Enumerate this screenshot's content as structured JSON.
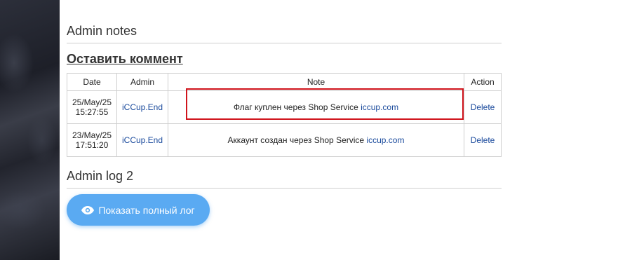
{
  "admin_notes": {
    "title": "Admin notes",
    "leave_comment": "Оставить коммент",
    "columns": {
      "date": "Date",
      "admin": "Admin",
      "note": "Note",
      "action": "Action"
    },
    "rows": [
      {
        "date_line1": "25/May/25",
        "date_line2": "15:27:55",
        "admin": "iCCup.End",
        "note_text": "Флаг куплен через Shop Service ",
        "note_link": "iccup.com",
        "action": "Delete"
      },
      {
        "date_line1": "23/May/25",
        "date_line2": "17:51:20",
        "admin": "iCCup.End",
        "note_text": "Аккаунт создан через Shop Service ",
        "note_link": "iccup.com",
        "action": "Delete"
      }
    ]
  },
  "admin_log": {
    "title": "Admin log 2",
    "show_full_log": "Показать полный лог",
    "button_icon": "eye-icon"
  },
  "colors": {
    "accent": "#5aaaf2",
    "link": "#1a4a9c",
    "highlight": "#d0141c"
  }
}
